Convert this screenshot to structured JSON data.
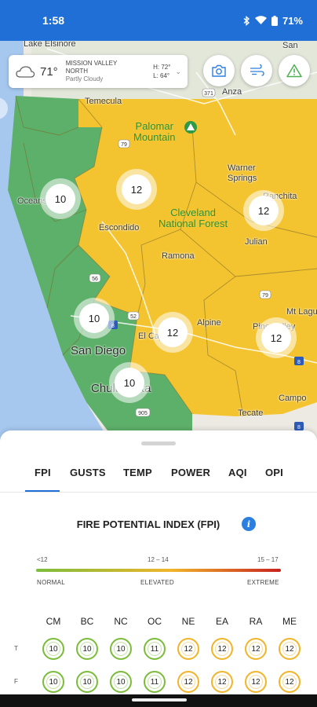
{
  "status": {
    "time": "1:58",
    "battery": "71%",
    "icons": [
      "bluetooth-icon",
      "wifi-icon",
      "battery-icon"
    ]
  },
  "weather": {
    "temp": "71°",
    "location_line1": "MISSION VALLEY",
    "location_line2": "NORTH",
    "condition": "Partly Cloudy",
    "high": "H: 72°",
    "low": "L: 64°",
    "icon": "partly-cloudy-icon"
  },
  "map": {
    "buttons": [
      "camera-icon",
      "wind-icon",
      "alert-icon"
    ],
    "places": {
      "lake_elsinore": "Lake Elsinore",
      "temecula": "Temecula",
      "palomar": "Palomar\nMountain",
      "warner": "Warner\nSprings",
      "ranchita": "Ranchita",
      "oceanside": "Oceanside",
      "escondido": "Escondido",
      "cleveland": "Cleveland\nNational Forest",
      "julian": "Julian",
      "ramona": "Ramona",
      "alpine": "Alpine",
      "el_cajon": "El Cajon",
      "san_diego": "San Diego",
      "chula_vista": "Chula Vista",
      "mt_laguna": "Mt Lagu",
      "pine_valley": "Pine Valley",
      "tecate": "Tecate",
      "campo": "Campo",
      "anza": "Anza",
      "san_label": "San"
    },
    "road_shields": [
      "79",
      "78",
      "56",
      "52",
      "8",
      "8",
      "905",
      "79",
      "371",
      "79"
    ],
    "clusters": [
      "10",
      "12",
      "12",
      "10",
      "12",
      "12",
      "10"
    ]
  },
  "sheet": {
    "tabs": [
      "FPI",
      "GUSTS",
      "TEMP",
      "POWER",
      "AQI",
      "OPI"
    ],
    "active_tab": "FPI",
    "title": "FIRE POTENTIAL INDEX (FPI)",
    "scale": {
      "ranges": [
        "<12",
        "12 – 14",
        "15 – 17"
      ],
      "levels": [
        "NORMAL",
        "ELEVATED",
        "EXTREME"
      ],
      "colors": {
        "normal": "#7bbd3b",
        "elevated": "#f1b52b",
        "extreme": "#c8221f"
      }
    },
    "grid": {
      "columns": [
        "CM",
        "BC",
        "NC",
        "OC",
        "NE",
        "EA",
        "RA",
        "ME"
      ],
      "rows": [
        {
          "label": "T",
          "values": [
            "10",
            "10",
            "10",
            "11",
            "12",
            "12",
            "12",
            "12"
          ]
        },
        {
          "label": "F",
          "values": [
            "10",
            "10",
            "10",
            "11",
            "12",
            "12",
            "12",
            "12"
          ]
        }
      ],
      "levels": [
        [
          "normal",
          "normal",
          "normal",
          "normal",
          "elevated",
          "elevated",
          "elevated",
          "elevated"
        ],
        [
          "normal",
          "normal",
          "normal",
          "normal",
          "elevated",
          "elevated",
          "elevated",
          "elevated"
        ]
      ]
    }
  }
}
